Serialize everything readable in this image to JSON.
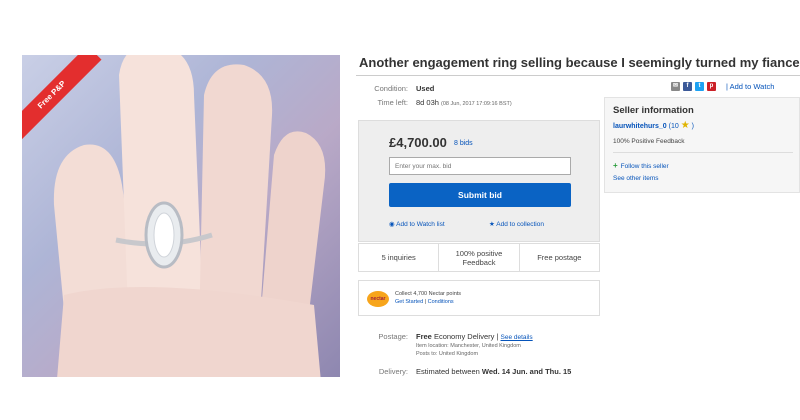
{
  "listing": {
    "title": "Another engagement ring selling because I seemingly turned my fiance gay.",
    "ribbon": "Free P&P",
    "condition_label": "Condition:",
    "condition_value": "Used",
    "time_label": "Time left:",
    "time_value": "8d 03h",
    "time_detail": "(08 Jun, 2017   17:09:16 BST)"
  },
  "share": {
    "icons": [
      "email-icon",
      "facebook-icon",
      "twitter-icon",
      "pinterest-icon"
    ],
    "watch_link": "| Add to Watch"
  },
  "bid": {
    "price": "£4,700.00",
    "bids": "8 bids",
    "input_placeholder": "Enter your max. bid",
    "submit_label": "Submit bid",
    "watch_label": "Add to Watch list",
    "collection_label": "Add to collection",
    "accent": "#0a63c4"
  },
  "stats": {
    "inquiries": "5 inquiries",
    "feedback_line1": "100% positive",
    "feedback_line2": "Feedback",
    "postage": "Free postage"
  },
  "nectar": {
    "logo_text": "nectar",
    "line1": "Collect 4,700 Nectar points",
    "get_started": "Get Started",
    "separator": "|",
    "conditions": "Conditions"
  },
  "postage": {
    "label": "Postage:",
    "free": "Free",
    "method": "Economy Delivery",
    "details_sep": "|",
    "details_link": "See details",
    "location": "Item location:  Manchester, United Kingdom",
    "posts_to": "Posts to:  United Kingdom"
  },
  "delivery": {
    "label": "Delivery:",
    "prefix": "Estimated between",
    "dates": "Wed. 14 Jun. and Thu. 15"
  },
  "seller": {
    "heading": "Seller information",
    "name": "laurwhitehurs_0",
    "score": "(10",
    "score_close": ")",
    "feedback": "100% Positive Feedback",
    "follow": "Follow this seller",
    "other_items": "See other items"
  }
}
